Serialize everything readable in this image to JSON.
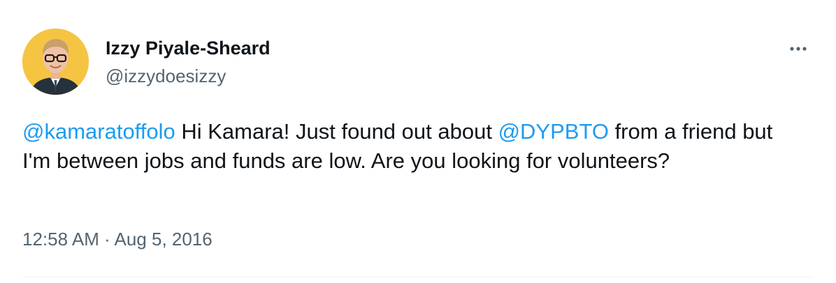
{
  "tweet": {
    "author": {
      "display_name": "Izzy Piyale-Sheard",
      "handle": "@izzydoesizzy"
    },
    "text": {
      "mention_1": "@kamaratoffolo",
      "segment_1": " Hi Kamara! Just found out about ",
      "mention_2": "@DYPBTO",
      "segment_2": " from a friend but I'm between jobs and funds are low. Are you looking for volunteers?"
    },
    "timestamp": {
      "time": "12:58 AM",
      "separator": " · ",
      "date": "Aug 5, 2016"
    },
    "icons": {
      "more": "more-horizontal-icon",
      "avatar": "profile-photo"
    },
    "colors": {
      "link": "#1d9bf0",
      "secondary_text": "#536471",
      "primary_text": "#0f1419",
      "avatar_background": "#f6c443"
    }
  }
}
